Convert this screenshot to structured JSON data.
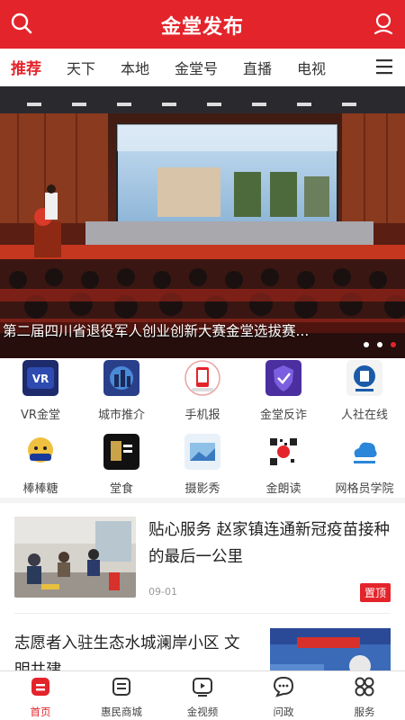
{
  "header": {
    "title": "金堂发布",
    "brand_color": "#e4242b"
  },
  "tabs": [
    {
      "label": "推荐",
      "active": true
    },
    {
      "label": "天下"
    },
    {
      "label": "本地"
    },
    {
      "label": "金堂号"
    },
    {
      "label": "直播"
    },
    {
      "label": "电视"
    }
  ],
  "banner": {
    "caption": "第二届四川省退役军人创业创新大赛金堂选拔赛...",
    "dots": 3,
    "active_dot": 2
  },
  "shortcuts": [
    {
      "label": "VR金堂",
      "icon": "vr-icon"
    },
    {
      "label": "城市推介",
      "icon": "city-promo-icon"
    },
    {
      "label": "手机报",
      "icon": "mobile-news-icon"
    },
    {
      "label": "金堂反诈",
      "icon": "anti-fraud-icon"
    },
    {
      "label": "人社在线",
      "icon": "social-security-icon"
    },
    {
      "label": "棒棒糖",
      "icon": "lollipop-icon"
    },
    {
      "label": "堂食",
      "icon": "dining-icon"
    },
    {
      "label": "摄影秀",
      "icon": "photo-show-icon"
    },
    {
      "label": "金朗读",
      "icon": "reading-icon"
    },
    {
      "label": "网格员学院",
      "icon": "grid-academy-icon"
    }
  ],
  "news": [
    {
      "title": "贴心服务 赵家镇连通新冠疫苗接种的最后一公里",
      "date": "09-01",
      "badge": "置顶"
    },
    {
      "title": "志愿者入驻生态水城澜岸小区 文明共建……"
    }
  ],
  "bottom_nav": [
    {
      "label": "首页",
      "icon": "home-icon",
      "active": true
    },
    {
      "label": "惠民商城",
      "icon": "shop-icon"
    },
    {
      "label": "金视频",
      "icon": "video-icon"
    },
    {
      "label": "问政",
      "icon": "chat-icon"
    },
    {
      "label": "服务",
      "icon": "services-icon"
    }
  ]
}
